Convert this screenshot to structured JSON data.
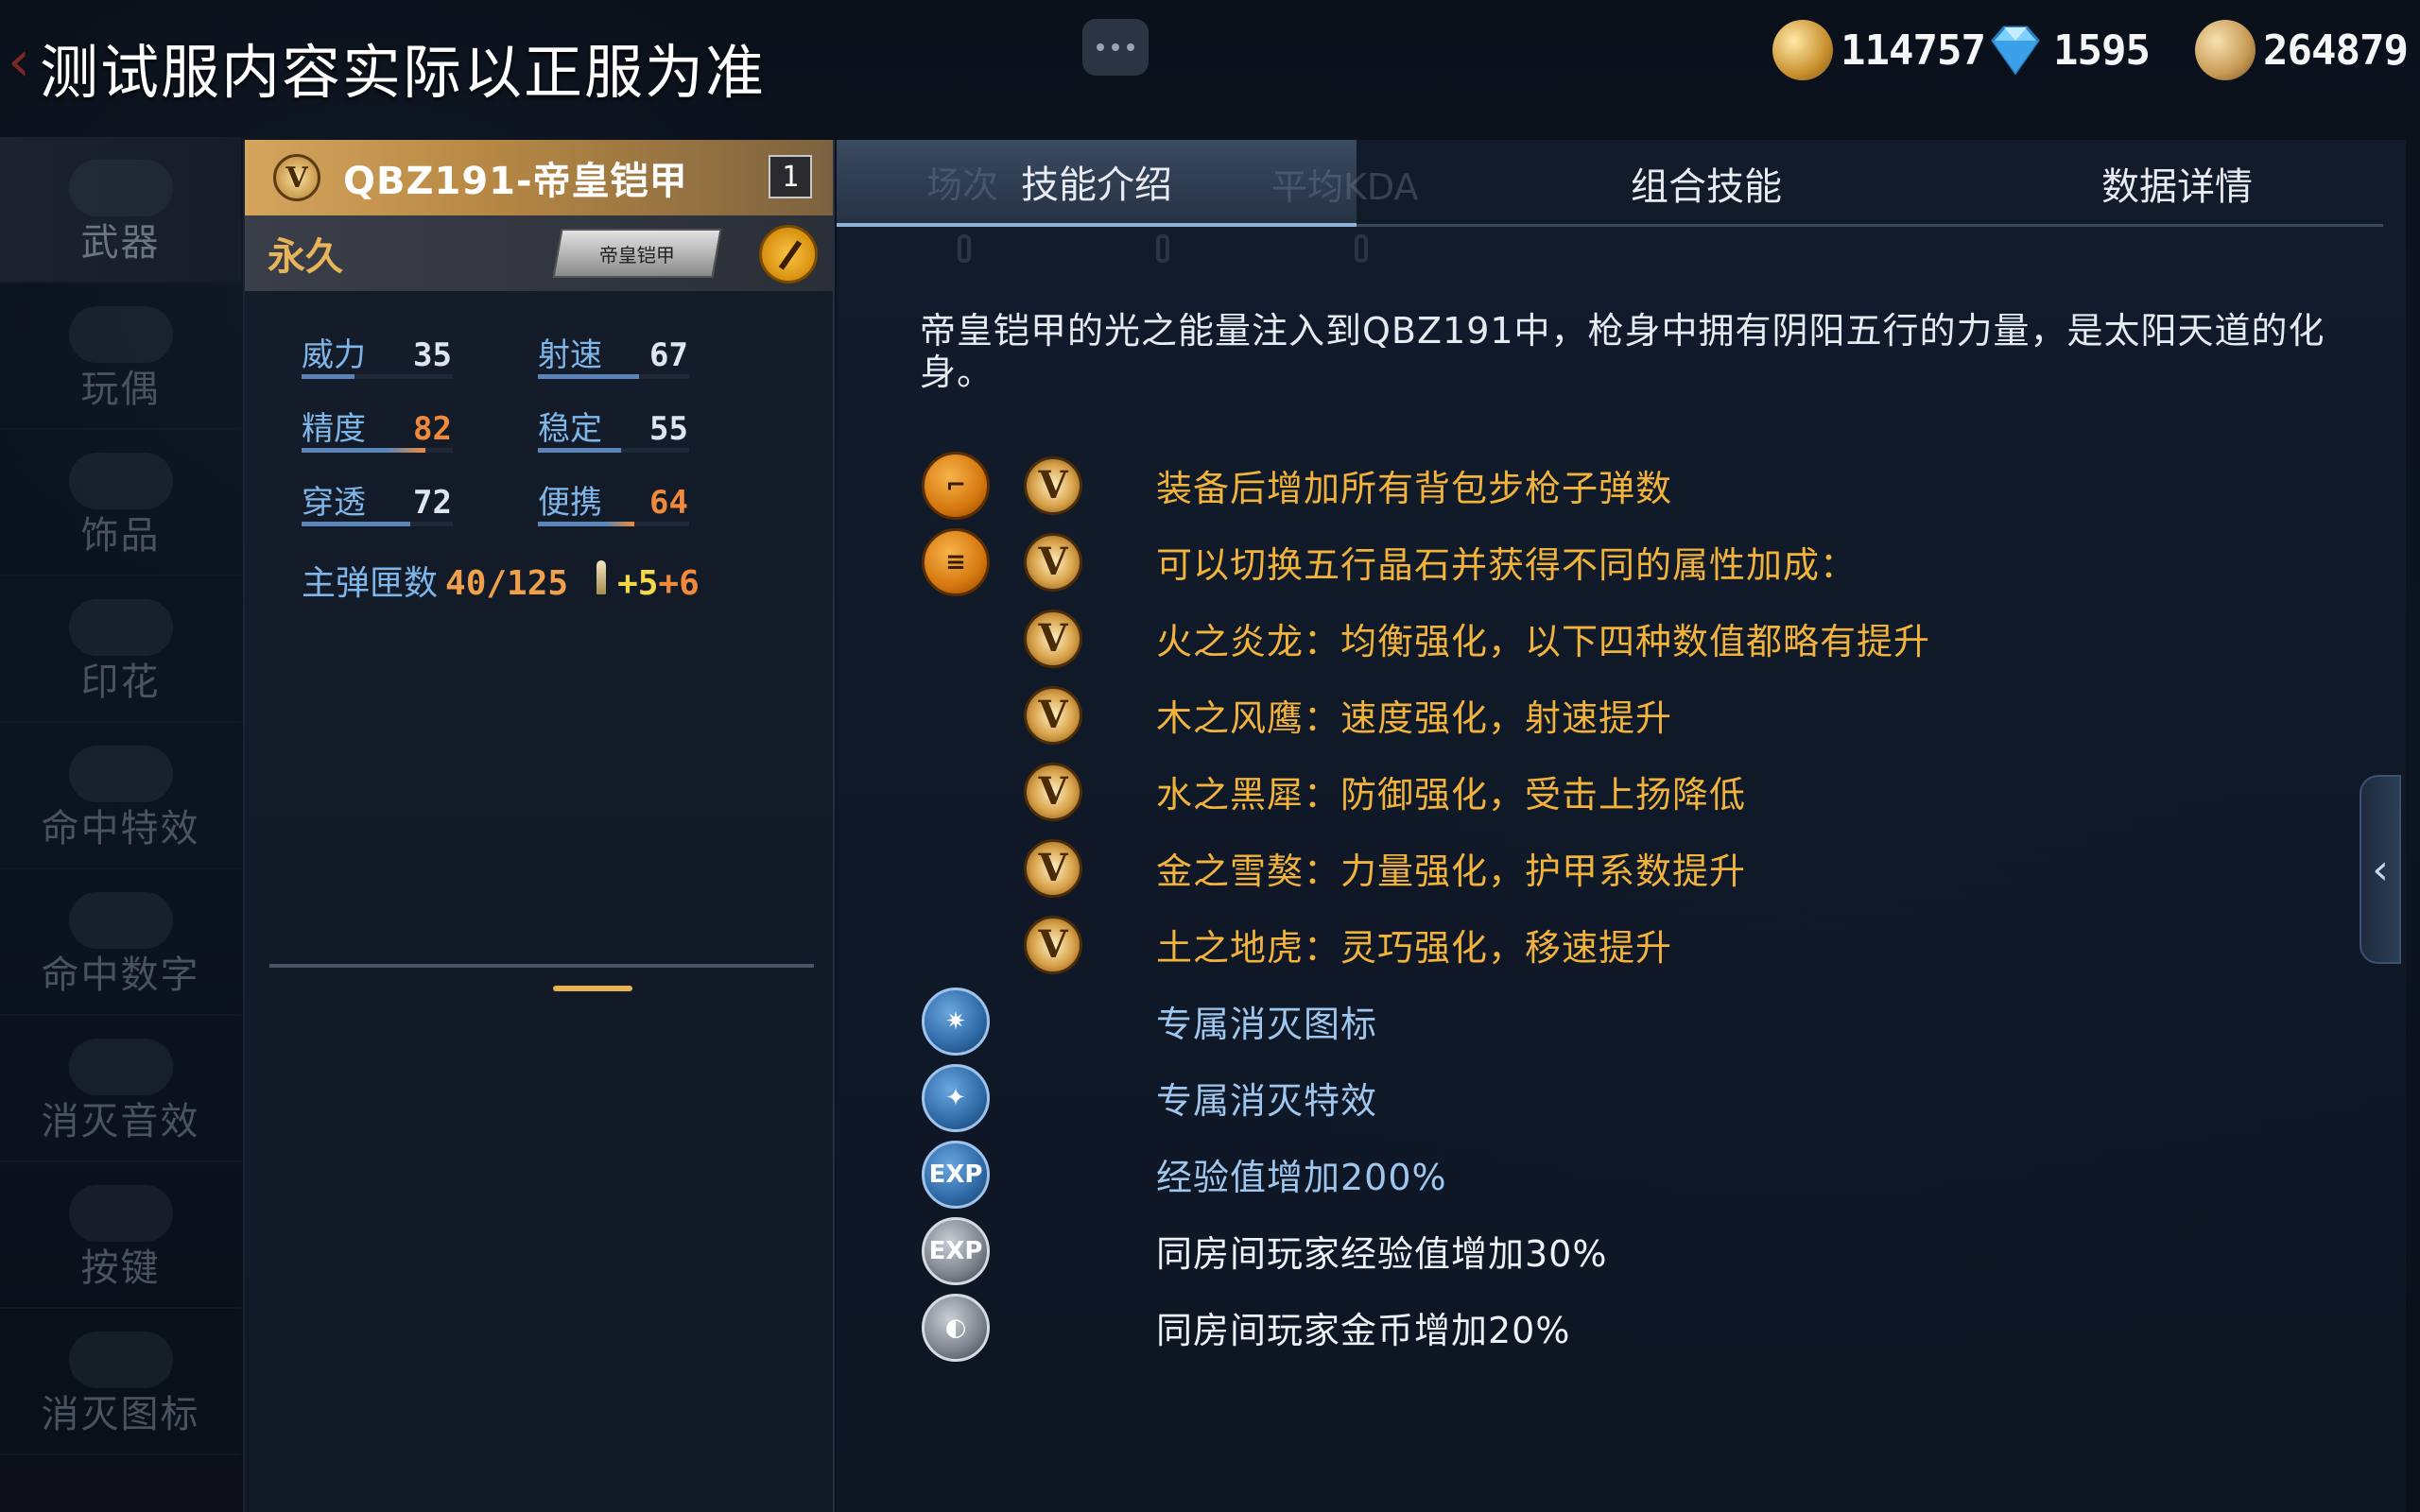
{
  "top": {
    "notice": "测试服内容实际以正服为准",
    "currencies": [
      {
        "name": "gold-currency",
        "value": "114757"
      },
      {
        "name": "diamond-currency",
        "value": "1595"
      },
      {
        "name": "coin-currency",
        "value": "264879"
      }
    ]
  },
  "sidebar": {
    "items": [
      {
        "label": "武器",
        "active": true
      },
      {
        "label": "玩偶"
      },
      {
        "label": "饰品"
      },
      {
        "label": "印花"
      },
      {
        "label": "命中特效"
      },
      {
        "label": "命中数字"
      },
      {
        "label": "消灭音效"
      },
      {
        "label": "按键"
      },
      {
        "label": "消灭图标"
      }
    ]
  },
  "card": {
    "title": "QBZ191-帝皇铠甲",
    "count": "1",
    "duration": "永久",
    "skin_tag": "帝皇铠甲",
    "stats": [
      {
        "label": "威力",
        "value": "35",
        "fill": 0.35,
        "highlight": false
      },
      {
        "label": "射速",
        "value": "67",
        "fill": 0.67,
        "highlight": false
      },
      {
        "label": "精度",
        "value": "82",
        "fill": 0.82,
        "highlight": true
      },
      {
        "label": "稳定",
        "value": "55",
        "fill": 0.55,
        "highlight": false
      },
      {
        "label": "穿透",
        "value": "72",
        "fill": 0.72,
        "highlight": false
      },
      {
        "label": "便携",
        "value": "64",
        "fill": 0.64,
        "highlight": true
      }
    ],
    "ammo_label": "主弹匣数",
    "ammo_value": "40/125",
    "ammo_bonus_a": "+5",
    "ammo_bonus_b": "+6"
  },
  "tabs": [
    {
      "label": "技能介绍",
      "active": true
    },
    {
      "label": "组合技能"
    },
    {
      "label": "数据详情"
    }
  ],
  "ghost_tabs": [
    "场次",
    "平均KDA"
  ],
  "description": "帝皇铠甲的光之能量注入到QBZ191中，枪身中拥有阴阳五行的力量，是太阳天道的化身。",
  "features": [
    {
      "icon": "rifle-ammo-icon",
      "icon_style": "orange",
      "glyph": "⌐",
      "vip": true,
      "color": "gold",
      "text": "装备后增加所有背包步枪子弹数"
    },
    {
      "icon": "bullets-icon",
      "icon_style": "orange",
      "glyph": "≡",
      "vip": true,
      "color": "gold",
      "text": "可以切换五行晶石并获得不同的属性加成："
    },
    {
      "icon": "",
      "icon_style": "",
      "vip": true,
      "color": "gold",
      "text": "火之炎龙：均衡强化，以下四种数值都略有提升"
    },
    {
      "icon": "",
      "icon_style": "",
      "vip": true,
      "color": "gold",
      "text": "木之风鹰：速度强化，射速提升"
    },
    {
      "icon": "",
      "icon_style": "",
      "vip": true,
      "color": "gold",
      "text": "水之黑犀：防御强化，受击上扬降低"
    },
    {
      "icon": "",
      "icon_style": "",
      "vip": true,
      "color": "gold",
      "text": "金之雪獒：力量强化，护甲系数提升"
    },
    {
      "icon": "",
      "icon_style": "",
      "vip": true,
      "color": "gold",
      "text": "土之地虎：灵巧强化，移速提升"
    },
    {
      "icon": "kill-icon-icon",
      "icon_style": "blue",
      "glyph": "✷",
      "vip": false,
      "color": "blue",
      "text": "专属消灭图标"
    },
    {
      "icon": "kill-effect-icon",
      "icon_style": "blue",
      "glyph": "✦",
      "vip": false,
      "color": "blue",
      "text": "专属消灭特效"
    },
    {
      "icon": "exp-boost-icon",
      "icon_style": "blue",
      "glyph": "EXP",
      "vip": false,
      "color": "blue",
      "text": "经验值增加200%"
    },
    {
      "icon": "room-exp-icon",
      "icon_style": "gray",
      "glyph": "EXP",
      "vip": false,
      "color": "white",
      "text": "同房间玩家经验值增加30%"
    },
    {
      "icon": "room-coin-icon",
      "icon_style": "gray",
      "glyph": "◐",
      "vip": false,
      "color": "white",
      "text": "同房间玩家金币增加20%"
    }
  ],
  "vip_badge_letter": "V",
  "colors": {
    "gold_text": "#f2b33d",
    "blue_text": "#9fc7ee",
    "stat_label": "#7fb6e8",
    "highlight_value": "#f08a3a"
  }
}
